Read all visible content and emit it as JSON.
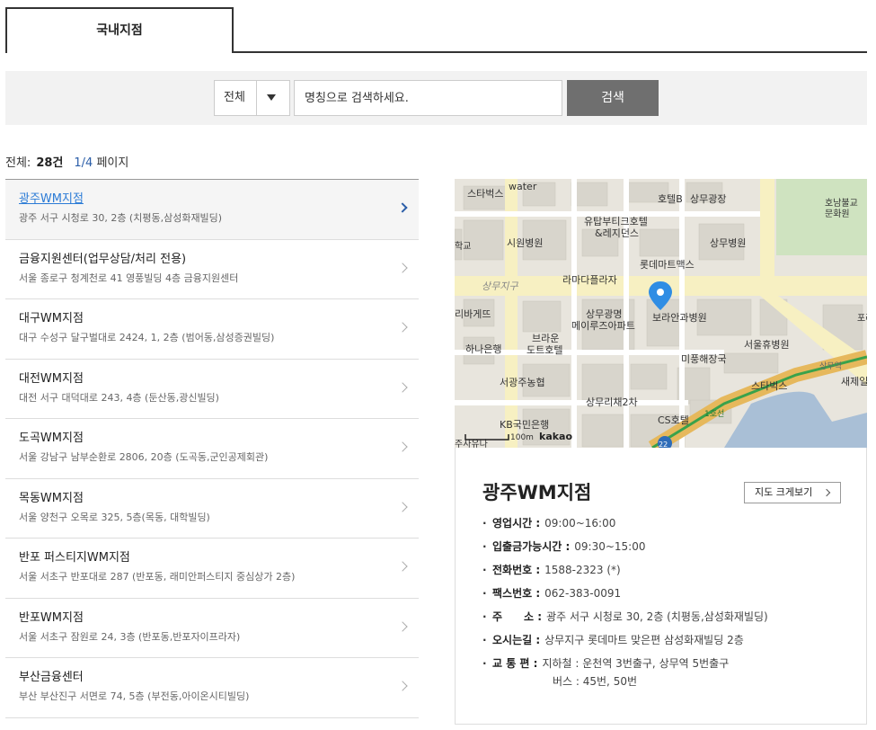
{
  "tabs": [
    {
      "label": "국내지점"
    }
  ],
  "search": {
    "select_value": "전체",
    "placeholder": "명칭으로 검색하세요.",
    "button_label": "검색"
  },
  "summary": {
    "total_label": "전체:",
    "total_count": "28건",
    "page": "1/4",
    "page_suffix": "페이지"
  },
  "branches": [
    {
      "name": "광주WM지점",
      "address": "광주 서구 시청로 30, 2층 (치평동,삼성화재빌딩)",
      "active": true
    },
    {
      "name": "금융지원센터(업무상담/처리 전용)",
      "address": "서울 종로구 청계천로 41 영풍빌딩 4층 금융지원센터"
    },
    {
      "name": "대구WM지점",
      "address": "대구 수성구 달구벌대로 2424, 1, 2층 (범어동,삼성증권빌딩)"
    },
    {
      "name": "대전WM지점",
      "address": "대전 서구 대덕대로 243, 4층 (둔산동,광신빌딩)"
    },
    {
      "name": "도곡WM지점",
      "address": "서울 강남구 남부순환로 2806, 20층 (도곡동,군인공제회관)"
    },
    {
      "name": "목동WM지점",
      "address": "서울 양천구 오목로 325, 5층(목동, 대학빌딩)"
    },
    {
      "name": "반포 퍼스티지WM지점",
      "address": "서울 서초구 반포대로 287 (반포동, 래미안퍼스티지 중심상가 2층)"
    },
    {
      "name": "반포WM지점",
      "address": "서울 서초구 잠원로 24, 3층 (반포동,반포자이프라자)"
    },
    {
      "name": "부산금융센터",
      "address": "부산 부산진구 서면로 74, 5층 (부전동,아이온시티빌딩)"
    }
  ],
  "map": {
    "labels": {
      "starbucks1": "스타벅스",
      "water": "water",
      "hotelb": "호텔B",
      "sangmu_plaza": "상무광장",
      "temple": "호남불교",
      "temple2": "문화원",
      "youtop": "유탑부티크호텔",
      "residence": "&레지던스",
      "city_hospital": "시원병원",
      "sangmu_hospital": "상무병원",
      "lotte_mart": "롯데마트맥스",
      "lamada": "라마다플라자",
      "district": "상무지구",
      "rebake": "리바게뜨",
      "sangmu_gwangmyeong": "상무광명",
      "meiru": "메이루즈아파트",
      "boran": "보라안과병원",
      "brown1": "브라운",
      "brown2": "도트호텔",
      "hana": "하나은행",
      "seoul_hyu": "서울휴병원",
      "mipung": "미풍해장국",
      "starbucks2": "스타벅스",
      "saejeil": "새제일",
      "nonghyup": "서광주농협",
      "sangmu_ri": "상무리채2차",
      "kb": "KB국민은행",
      "cs_hotel": "CS호텔",
      "scale": "100m",
      "brand": "kakao",
      "road_num": "22",
      "line1": "1호선",
      "sangmu_station": "상무역",
      "hak": "학교",
      "po": "포레",
      "bottom_left": "주사유나"
    }
  },
  "detail": {
    "title": "광주WM지점",
    "enlarge_label": "지도 크게보기",
    "rows": [
      {
        "label": "영업시간 :",
        "value": "09:00~16:00"
      },
      {
        "label": "입출금가능시간 :",
        "value": "09:30~15:00"
      },
      {
        "label": "전화번호 :",
        "value": "1588-2323 (*)"
      },
      {
        "label": "팩스번호 :",
        "value": "062-383-0091"
      },
      {
        "label": "주　　소 :",
        "value": "광주 서구 시청로 30, 2층 (치평동,삼성화재빌딩)"
      },
      {
        "label": "오시는길 :",
        "value": "상무지구 롯데마트 맞은편 삼성화재빌딩 2층"
      },
      {
        "label": "교 통 편 :",
        "value": "지하철 : 운천역 3번출구, 상무역 5번출구",
        "value2": "버스 : 45번, 50번"
      }
    ]
  }
}
